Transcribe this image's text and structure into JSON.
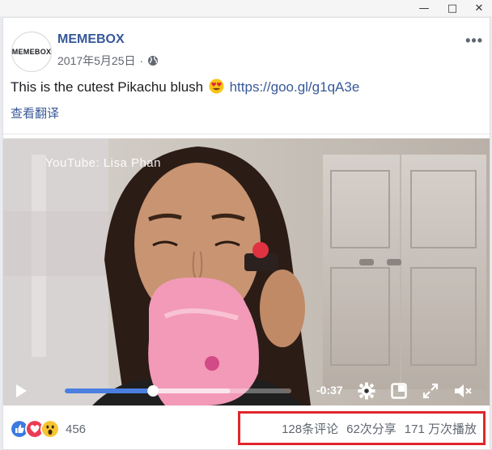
{
  "window": {
    "minimize": "—",
    "maximize": "□",
    "close": "✕"
  },
  "post": {
    "page_name": "MEMEBOX",
    "avatar_text": "MEMEBOX",
    "date": "2017年5月25日",
    "privacy_icon": "globe-icon",
    "more": "•••",
    "text": "This is the cutest Pikachu blush",
    "emoji": "heart-eyes-emoji",
    "link": "https://goo.gl/g1qA3e",
    "translate": "查看翻译"
  },
  "video": {
    "watermark": "YouTube: Lisa Phan",
    "time_remaining": "-0:37",
    "progress": 0.39,
    "buffered": 0.73,
    "controls": [
      "play-icon",
      "gear-icon",
      "pip-icon",
      "fullscreen-icon",
      "volume-muted-icon"
    ]
  },
  "stats": {
    "reaction_count": "456",
    "reactions": [
      "like",
      "love",
      "wow"
    ],
    "comments": "128条评论",
    "shares": "62次分享",
    "views": "171 万次播放"
  },
  "colors": {
    "link": "#385898",
    "name": "#365899",
    "highlight": "#e0262b",
    "progress": "#4a7fe0"
  }
}
